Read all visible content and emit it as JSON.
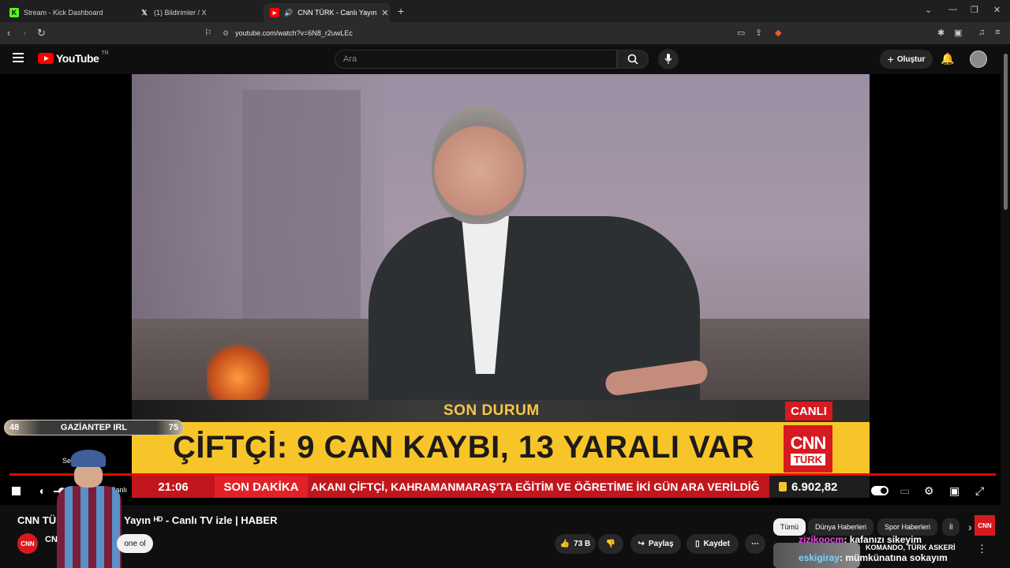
{
  "browser": {
    "tabs": [
      {
        "label": "Stream - Kick Dashboard",
        "favicon": "K",
        "favicon_color": "#53fc18"
      },
      {
        "label": "(1) Bildirimler / X",
        "favicon": "X",
        "favicon_color": "#ffffff"
      },
      {
        "label": "CNN TÜRK - Canlı Yayın",
        "favicon": "▶",
        "favicon_color": "#ff0000"
      }
    ],
    "url": "youtube.com/watch?v=6N8_r2uwLEc"
  },
  "youtube": {
    "logo_text": "YouTube",
    "region": "TR",
    "search_placeholder": "Ara",
    "create_label": "Oluştur"
  },
  "video": {
    "banner_top": "SON DURUM",
    "live_tag": "CANLI",
    "headline": "ÇİFTÇİ: 9 CAN KAYBI, 13 YARALI VAR",
    "cnn_logo_top": "CNN",
    "cnn_logo_bottom": "TÜRK",
    "ticker_time": "21:06",
    "ticker_label": "SON DAKİKA",
    "ticker_text": "AKANI ÇİFTÇİ, KAHRAMANMARAŞ'TA EĞİTİM VE ÖĞRETİME İKİ GÜN ARA VERİLDİĞ",
    "bist_value": "6.902,82",
    "progress_fraction": 1.0
  },
  "controls": {
    "live_label": "Canlı",
    "volume_tooltip": "Ses"
  },
  "overlay": {
    "bar_left": "48",
    "bar_label": "GAZİANTEP IRL",
    "bar_right": "75"
  },
  "below": {
    "title": "CNN TÜRK - Canlı Yayın ᴴᴰ - Canlı TV izle | HABER",
    "title_visible": "CNN TÜ",
    "title_rest": "Yayın ᴴᴰ - Canlı TV izle | HABER",
    "channel_avatar_text": "CNN",
    "channel_name": "CN",
    "subscribe_label": "one ol",
    "likes": "73 B",
    "share_label": "Paylaş",
    "save_label": "Kaydet"
  },
  "chips": [
    "Tümü",
    "Dünya Haberleri",
    "Spor Haberleri",
    "İl"
  ],
  "recommended": {
    "title": "KOMANDO, TÜRK ASKERİ"
  },
  "chat": [
    {
      "user": "zizikoocm",
      "message": ": kafanızı sikeyim"
    },
    {
      "user": "eskigiray",
      "message": ": mümkünatına sokayım"
    }
  ]
}
